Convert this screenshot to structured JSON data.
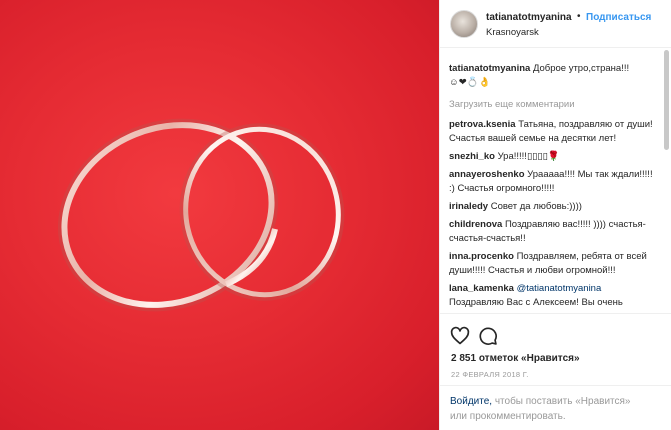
{
  "post": {
    "username": "tatianatotmyanina",
    "separator": "•",
    "follow_label": "Подписаться",
    "location": "Krasnoyarsk"
  },
  "caption": {
    "username": "tatianatotmyanina",
    "text": "Доброе утро,страна!!!",
    "emojis": "☺❤💍👌"
  },
  "load_more_label": "Загрузить еще комментарии",
  "comments": [
    {
      "user": "petrova.ksenia",
      "text": "Татьяна, поздравляю от души! Счастья вашей семье на десятки лет!"
    },
    {
      "user": "snezhi_ko",
      "text": "Ура!!!!!▯▯▯▯🌹"
    },
    {
      "user": "annayeroshenko",
      "text": "Урааааа!!!! Мы так ждали!!!!! :) Счастья огромного!!!!!"
    },
    {
      "user": "irinaledy",
      "text": "Совет да любовь:))))"
    },
    {
      "user": "childrenova",
      "text": "Поздравляю вас!!!!! )))) счастья-счастья-счастья!!"
    },
    {
      "user": "inna.procenko",
      "text": "Поздравляем, ребята от всей души!!!!! Счастья и любви огромной!!!"
    },
    {
      "user": "lana_kamenka",
      "mention": "@tatianatotmyanina",
      "text": "Поздравляю Вас с Алексеем! Вы очень"
    }
  ],
  "likes": {
    "count": "2 851",
    "text": "отметок «Нравится»"
  },
  "date": "22 ФЕВРАЛЯ 2018 Г.",
  "login": {
    "link": "Войдите,",
    "mid": "чтобы поставить «Нравится»",
    "rest": "или прокомментировать."
  },
  "icons": {
    "heart": "heart-icon",
    "comment": "comment-bubble-icon"
  },
  "colors": {
    "photo_bg": "#e52b33",
    "link": "#003569",
    "follow": "#3897f0",
    "muted": "#999999"
  }
}
